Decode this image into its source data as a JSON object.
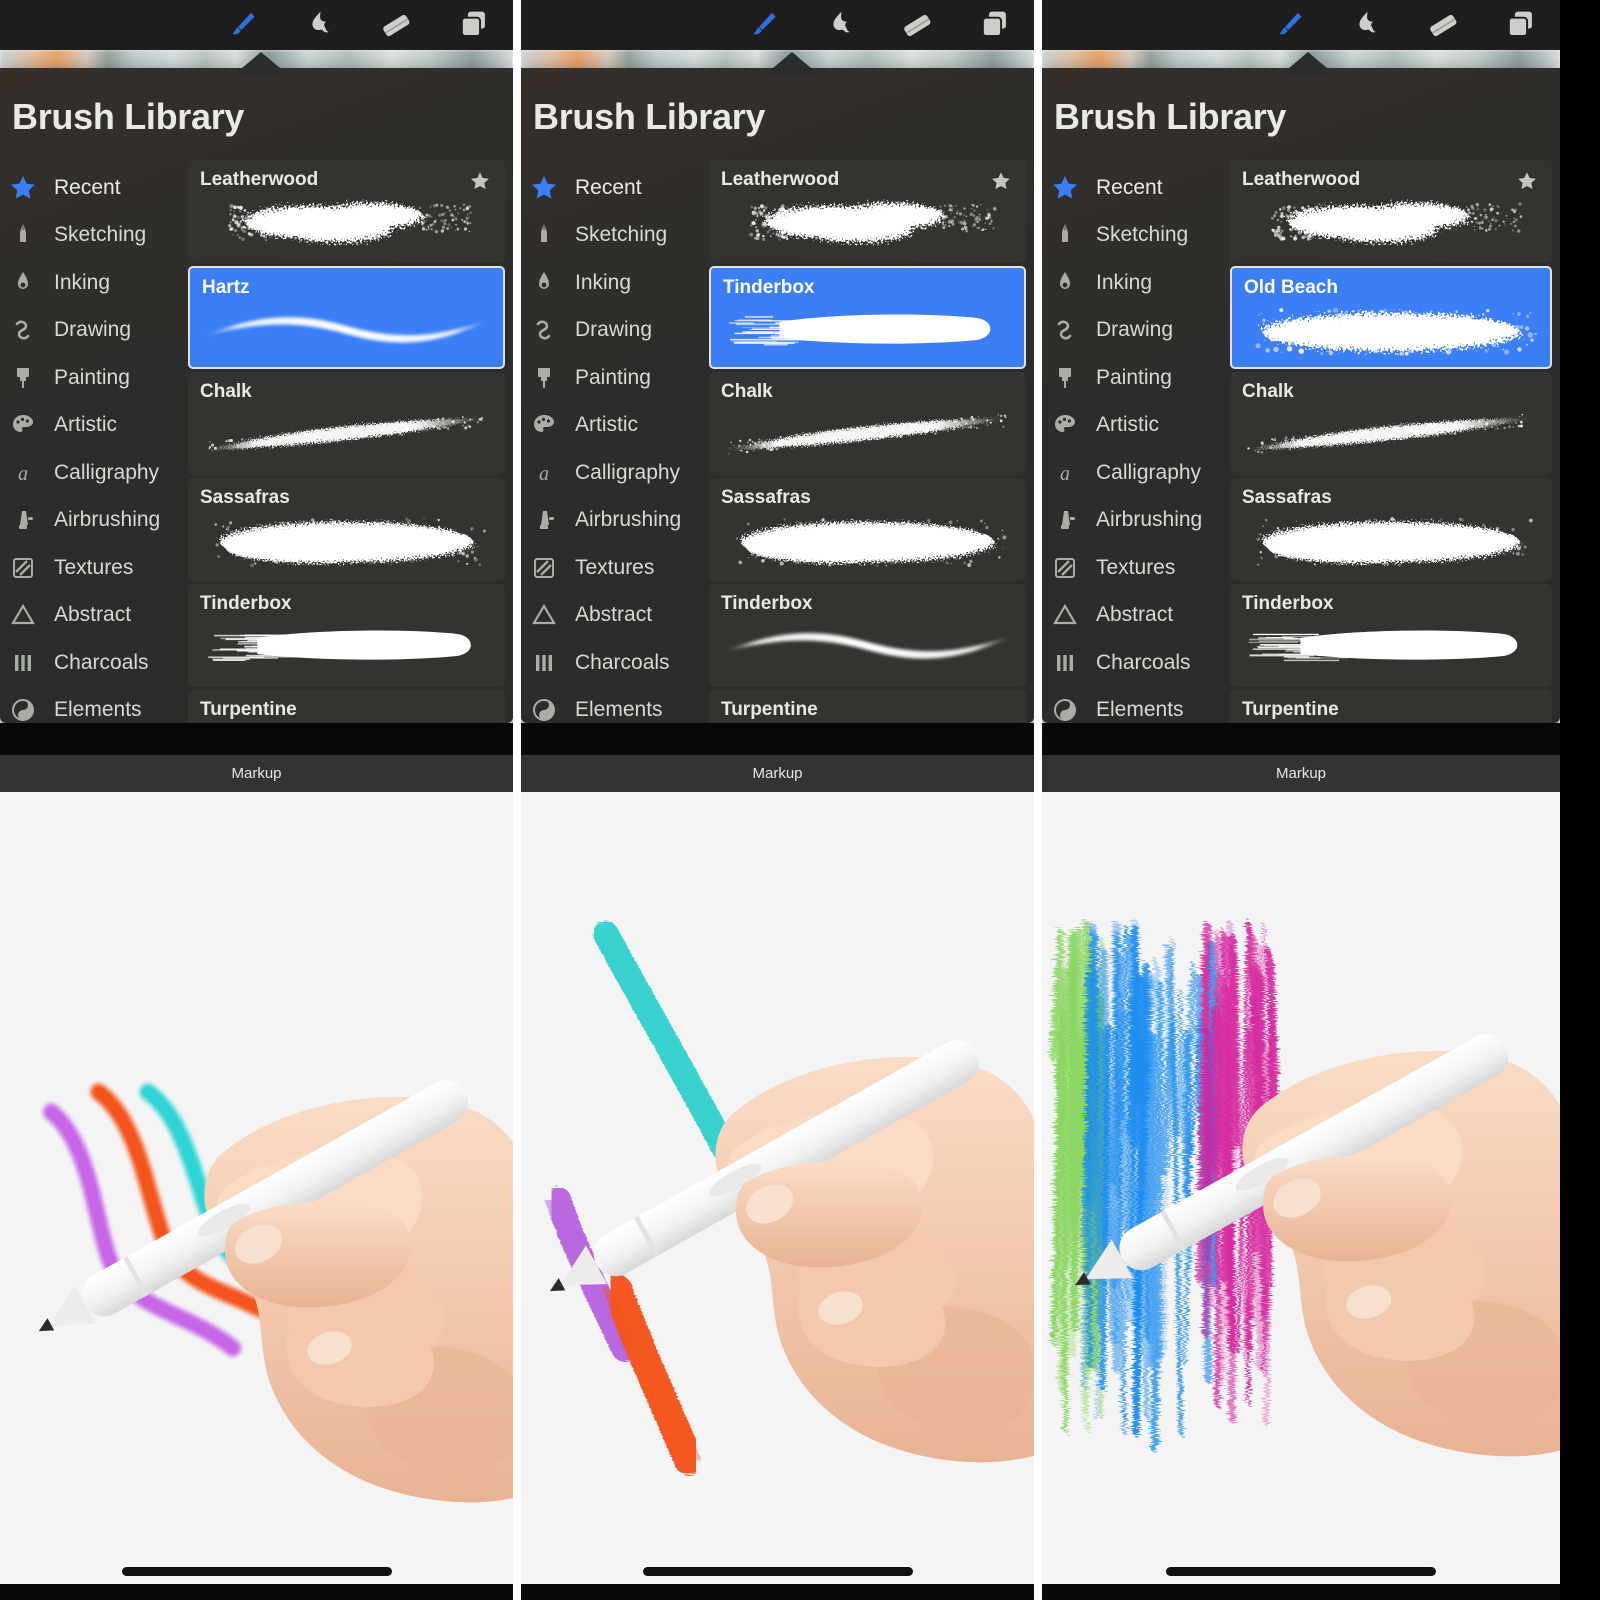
{
  "app": {
    "popover_title": "Brush Library",
    "markup_label": "Markup"
  },
  "toolbar": {
    "tools": [
      {
        "name": "paintbrush-icon",
        "label": "Paintbrush",
        "active": true
      },
      {
        "name": "smudge-icon",
        "label": "Smudge",
        "active": false
      },
      {
        "name": "eraser-icon",
        "label": "Eraser",
        "active": false
      },
      {
        "name": "layers-icon",
        "label": "Layers",
        "active": false
      }
    ]
  },
  "sidebar": {
    "items": [
      {
        "label": "Recent",
        "icon": "star-icon",
        "active": true
      },
      {
        "label": "Sketching",
        "icon": "pencil-tip-icon",
        "active": false
      },
      {
        "label": "Inking",
        "icon": "nib-icon",
        "active": false
      },
      {
        "label": "Drawing",
        "icon": "squiggle-icon",
        "active": false
      },
      {
        "label": "Painting",
        "icon": "paint-brush-icon",
        "active": false
      },
      {
        "label": "Artistic",
        "icon": "palette-icon",
        "active": false
      },
      {
        "label": "Calligraphy",
        "icon": "letter-a-icon",
        "active": false
      },
      {
        "label": "Airbrushing",
        "icon": "airbrush-icon",
        "active": false
      },
      {
        "label": "Textures",
        "icon": "hatch-square-icon",
        "active": false
      },
      {
        "label": "Abstract",
        "icon": "triangle-icon",
        "active": false
      },
      {
        "label": "Charcoals",
        "icon": "three-bars-icon",
        "active": false
      },
      {
        "label": "Elements",
        "icon": "yin-yang-icon",
        "active": false
      }
    ]
  },
  "colors": {
    "accent_blue": "#3b7ef6",
    "panel_bg": "#2b2d2b",
    "row_bg": "#32352f",
    "toolbar_bg": "#1e1e1e",
    "markup_bg": "#333333",
    "canvas_bg": "#f4f4f4",
    "text_primary": "#e9e9e6",
    "text_secondary": "#d7d9d5"
  },
  "panels": [
    {
      "id": "panel-1",
      "selected_brush": "Hartz",
      "brushes": [
        {
          "name": "Leatherwood",
          "favorite": true,
          "selected": false,
          "swatch": "speckled-cloud"
        },
        {
          "name": "Hartz",
          "favorite": false,
          "selected": true,
          "swatch": "smooth-taper"
        },
        {
          "name": "Chalk",
          "favorite": false,
          "selected": false,
          "swatch": "grainy-taper"
        },
        {
          "name": "Sassafras",
          "favorite": false,
          "selected": false,
          "swatch": "rough-blob"
        },
        {
          "name": "Tinderbox",
          "favorite": false,
          "selected": false,
          "swatch": "flat-bristle"
        },
        {
          "name": "Turpentine",
          "favorite": false,
          "selected": false,
          "swatch": "wispy-edge"
        }
      ],
      "canvas_strokes": [
        {
          "color": "#c767e8",
          "style": "smooth-s-curve",
          "name": "purple-stroke"
        },
        {
          "color": "#f4551f",
          "style": "smooth-s-curve",
          "name": "orange-stroke"
        },
        {
          "color": "#2fd4d4",
          "style": "smooth-s-curve",
          "name": "cyan-stroke"
        }
      ]
    },
    {
      "id": "panel-2",
      "selected_brush": "Tinderbox",
      "brushes": [
        {
          "name": "Leatherwood",
          "favorite": true,
          "selected": false,
          "swatch": "speckled-cloud"
        },
        {
          "name": "Tinderbox",
          "favorite": false,
          "selected": true,
          "swatch": "flat-bristle"
        },
        {
          "name": "Chalk",
          "favorite": false,
          "selected": false,
          "swatch": "grainy-taper"
        },
        {
          "name": "Sassafras",
          "favorite": false,
          "selected": false,
          "swatch": "rough-blob"
        },
        {
          "name": "Tinderbox",
          "favorite": false,
          "selected": false,
          "swatch": "smooth-taper"
        },
        {
          "name": "Turpentine",
          "favorite": false,
          "selected": false,
          "swatch": "wispy-edge"
        }
      ],
      "canvas_strokes": [
        {
          "color": "#b866e0",
          "style": "bristle-streak",
          "name": "purple-stroke"
        },
        {
          "color": "#f4551f",
          "style": "bristle-streak",
          "name": "orange-stroke"
        },
        {
          "color": "#36d2cd",
          "style": "bristle-streak",
          "name": "cyan-stroke"
        }
      ]
    },
    {
      "id": "panel-3",
      "selected_brush": "Old Beach",
      "brushes": [
        {
          "name": "Leatherwood",
          "favorite": true,
          "selected": false,
          "swatch": "speckled-cloud"
        },
        {
          "name": "Old Beach",
          "favorite": false,
          "selected": true,
          "swatch": "mottled-blob"
        },
        {
          "name": "Chalk",
          "favorite": false,
          "selected": false,
          "swatch": "grainy-taper"
        },
        {
          "name": "Sassafras",
          "favorite": false,
          "selected": false,
          "swatch": "rough-blob"
        },
        {
          "name": "Tinderbox",
          "favorite": false,
          "selected": false,
          "swatch": "flat-bristle"
        },
        {
          "name": "Turpentine",
          "favorite": false,
          "selected": false,
          "swatch": "wispy-edge"
        }
      ],
      "canvas_strokes": [
        {
          "color": "#7ad14a",
          "style": "dry-scrub",
          "name": "green-stroke"
        },
        {
          "color": "#1a8bf0",
          "style": "dry-scrub",
          "name": "blue-stroke"
        },
        {
          "color": "#d4209a",
          "style": "dry-scrub",
          "name": "magenta-stroke"
        }
      ]
    }
  ]
}
